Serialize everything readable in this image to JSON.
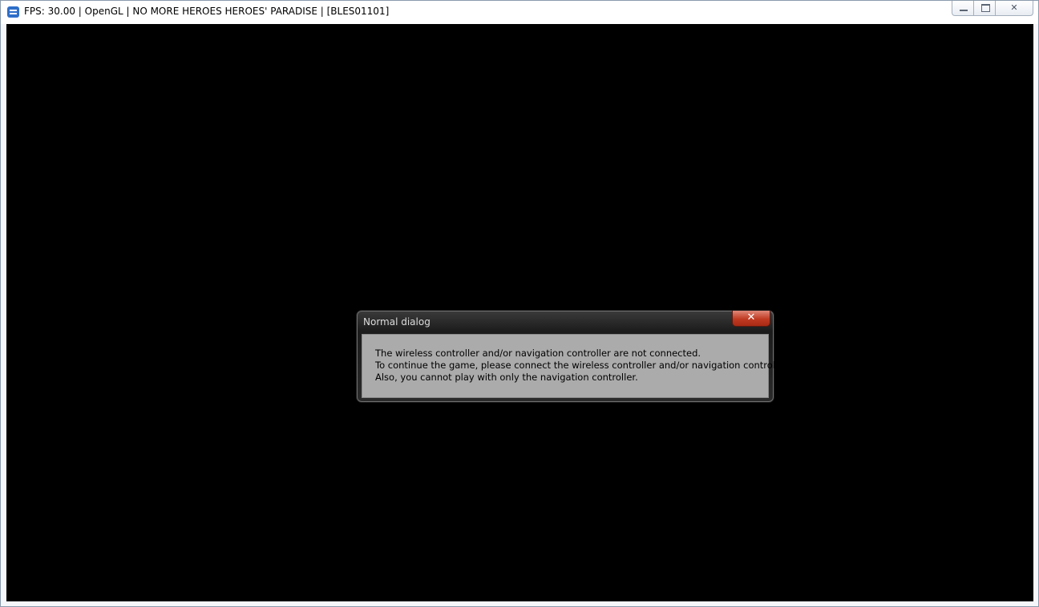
{
  "window": {
    "title": "FPS: 30.00 | OpenGL | NO MORE HEROES HEROES' PARADISE | [BLES01101]",
    "icon": "rpcs3-app-icon",
    "controls": {
      "minimize_icon": "minimize-icon",
      "maximize_icon": "maximize-icon",
      "close_glyph": "✕"
    }
  },
  "dialog": {
    "title": "Normal dialog",
    "close_glyph": "✕",
    "lines": [
      "The wireless controller and/or navigation controller are not connected.",
      "To continue the game, please connect the wireless controller and/or navigation controller.",
      "Also, you cannot play with only the navigation controller."
    ]
  },
  "colors": {
    "game_background": "#000000",
    "dialog_body": "#ababab",
    "close_button": "#c03a22"
  }
}
